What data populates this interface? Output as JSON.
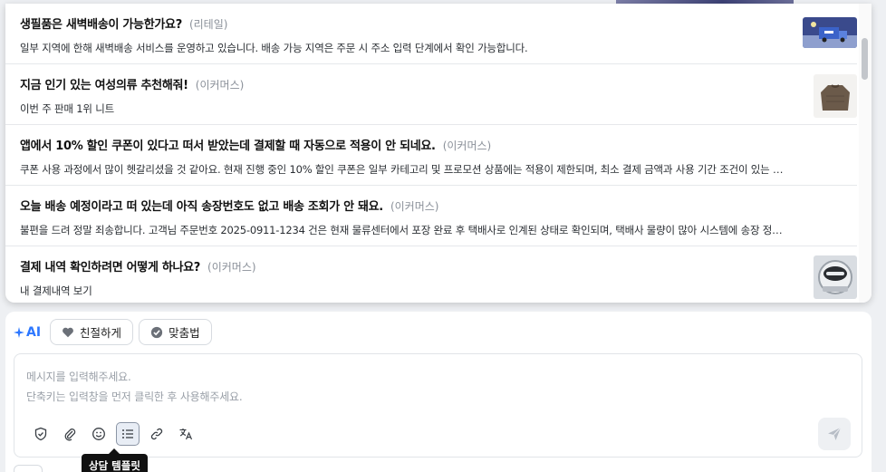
{
  "suggestions": [
    {
      "question": "생필품은 새벽배송이 가능한가요?",
      "category": "(리테일)",
      "answer": "일부 지역에 한해 새벽배송 서비스를 운영하고 있습니다. 배송 가능 지역은 주문 시 주소 입력 단계에서 확인 가능합니다.",
      "thumb": "delivery-truck-image"
    },
    {
      "question": "지금 인기 있는 여성의류 추천해줘!",
      "category": "(이커머스)",
      "answer": "이번 주 판매 1위 니트",
      "thumb": "knit-sweater-image"
    },
    {
      "question": "앱에서 10% 할인 쿠폰이 있다고 떠서 받았는데 결제할 때 자동으로 적용이 안 되네요.",
      "category": "(이커머스)",
      "answer": "쿠폰 사용 과정에서 많이 헷갈리셨을 것 같아요. 현재 진행 중인 10% 할인 쿠폰은 일부 카테고리 및 프로모션 상품에는 적용이 제한되며, 최소 결제 금액과 사용 기간 조건이 있는 경…",
      "thumb": ""
    },
    {
      "question": "오늘 배송 예정이라고 떠 있는데 아직 송장번호도 없고 배송 조회가 안 돼요.",
      "category": "(이커머스)",
      "answer": "불편을 드려 정말 죄송합니다. 고객님 주문번호 2025-0911-1234 건은 현재 물류센터에서 포장 완료 후 택배사로 인계된 상태로 확인되며, 택배사 물량이 많아 시스템에 송장 정보 반…",
      "thumb": ""
    },
    {
      "question": "결제 내역 확인하려면 어떻게 하나요?",
      "category": "(이커머스)",
      "answer": "내 결제내역 보기",
      "thumb": "payment-robot-image"
    }
  ],
  "ai": {
    "label": "AI",
    "chips": [
      {
        "label": "친절하게",
        "icon": "heart-icon"
      },
      {
        "label": "맞춤법",
        "icon": "check-circle-icon"
      }
    ]
  },
  "composer": {
    "placeholder_line1": "메시지를 입력해주세요.",
    "placeholder_line2": "단축키는 입력창을 먼저 클릭한 후 사용해주세요.",
    "tools": [
      "shield-icon",
      "paperclip-icon",
      "emoji-icon",
      "list-template-icon",
      "link-icon",
      "translate-icon"
    ],
    "active_tool": "list-template-icon",
    "send_icon": "send-icon"
  },
  "tooltip": {
    "text": "상담 템플릿"
  },
  "colors": {
    "accent": "#2c77ff",
    "border": "#d7dbe0",
    "tooltip_bg": "#111111"
  }
}
